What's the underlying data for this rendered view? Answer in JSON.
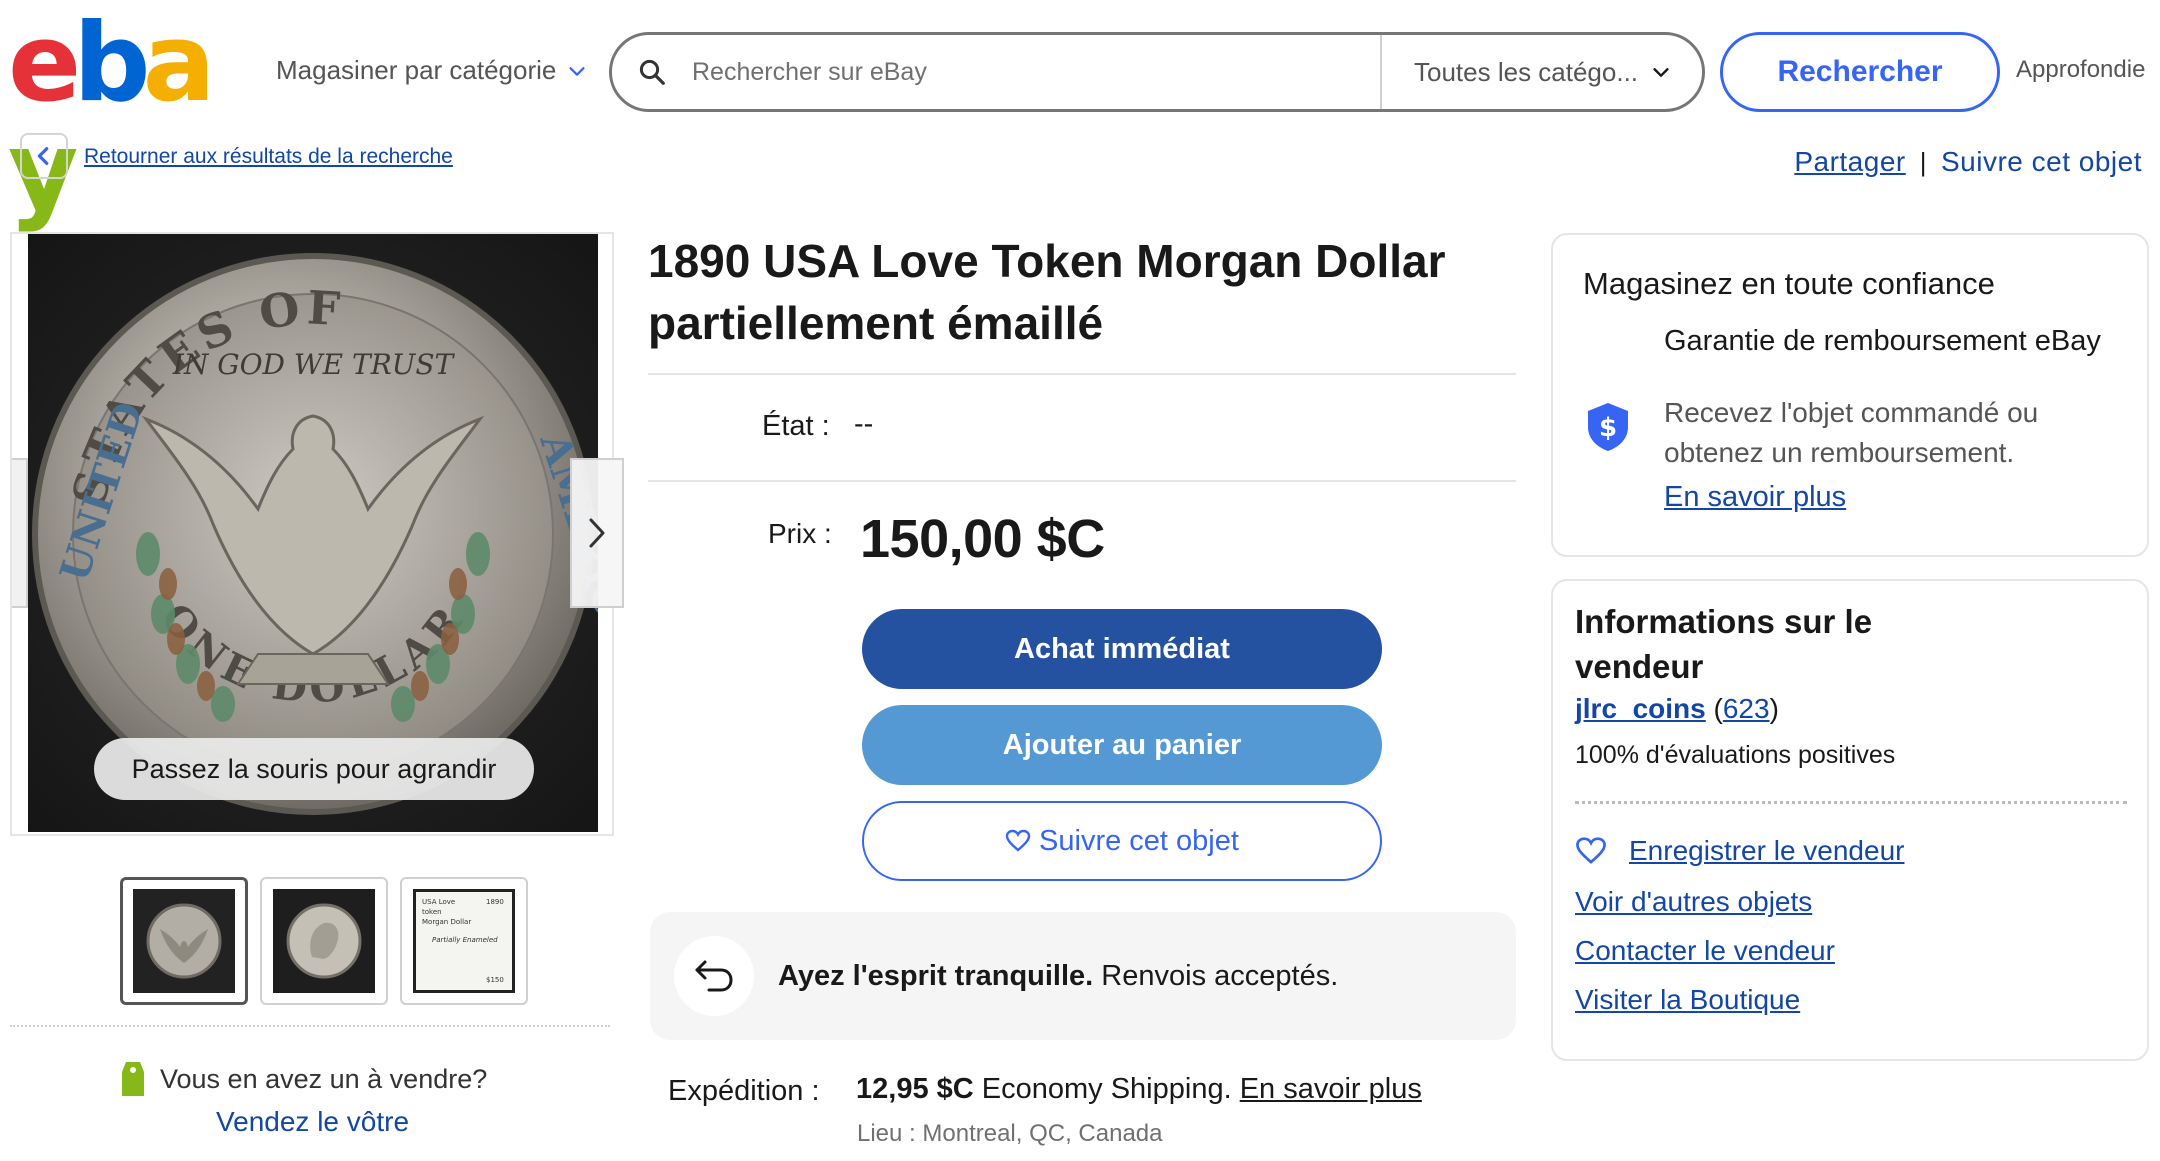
{
  "header": {
    "logo_letters": [
      {
        "ch": "e",
        "color": "#e53238"
      },
      {
        "ch": "b",
        "color": "#0064d2"
      },
      {
        "ch": "a",
        "color": "#f5af02"
      },
      {
        "ch": "y",
        "color": "#86b817"
      }
    ],
    "shop_by_category": "Magasiner par catégorie",
    "search_placeholder": "Rechercher sur eBay",
    "category_select": "Toutes les catégo...",
    "search_button": "Rechercher",
    "advanced": "Approfondie"
  },
  "subnav": {
    "back_link": "Retourner aux résultats de la recherche",
    "share": "Partager",
    "separator": "|",
    "watch": "Suivre cet objet"
  },
  "gallery": {
    "hover_hint": "Passez la souris pour agrandir",
    "sell_question": "Vous en avez un à vendre?",
    "sell_link": "Vendez le vôtre",
    "coin_legend": "IN GOD WE TRUST",
    "coin_top": "STATES OF",
    "coin_left": "UNITED",
    "coin_right": "AMERICA",
    "coin_bottom": "ONE DOLLAR",
    "thumbnail_note": [
      "USA Love",
      "token",
      "Morgan Dollar",
      "Partially Enameled",
      "$150"
    ],
    "thumbnail_year": "1890"
  },
  "item": {
    "title": "1890 USA Love Token Morgan Dollar partiellement émaillé",
    "condition_label": "État :",
    "condition_value": "--",
    "price_label": "Prix :",
    "price": "150,00 $C",
    "buy_now": "Achat immédiat",
    "add_to_cart": "Ajouter au panier",
    "watch": "Suivre cet objet",
    "returns_bold": "Ayez l'esprit tranquille.",
    "returns_text": "Renvois acceptés.",
    "shipping_label": "Expédition :",
    "shipping_price": "12,95 $C",
    "shipping_method": "Economy Shipping.",
    "shipping_link": "En savoir plus",
    "location": "Lieu : Montreal, QC, Canada"
  },
  "confidence": {
    "title": "Magasinez en toute confiance",
    "guarantee": "Garantie de remboursement eBay",
    "description": "Recevez l'objet commandé ou obtenez un remboursement.",
    "learn_more": "En savoir plus"
  },
  "seller": {
    "title": "Informations sur le vendeur",
    "name": "jlrc_coins",
    "feedback_count": "623",
    "positive": "100% d'évaluations positives",
    "save": "Enregistrer le vendeur",
    "links": [
      "Voir d'autres objets",
      "Contacter le vendeur",
      "Visiter la Boutique"
    ]
  },
  "colors": {
    "link": "#1346a5",
    "accent": "#3665f3",
    "buy": "#2451a0",
    "cart": "#5499d3"
  }
}
